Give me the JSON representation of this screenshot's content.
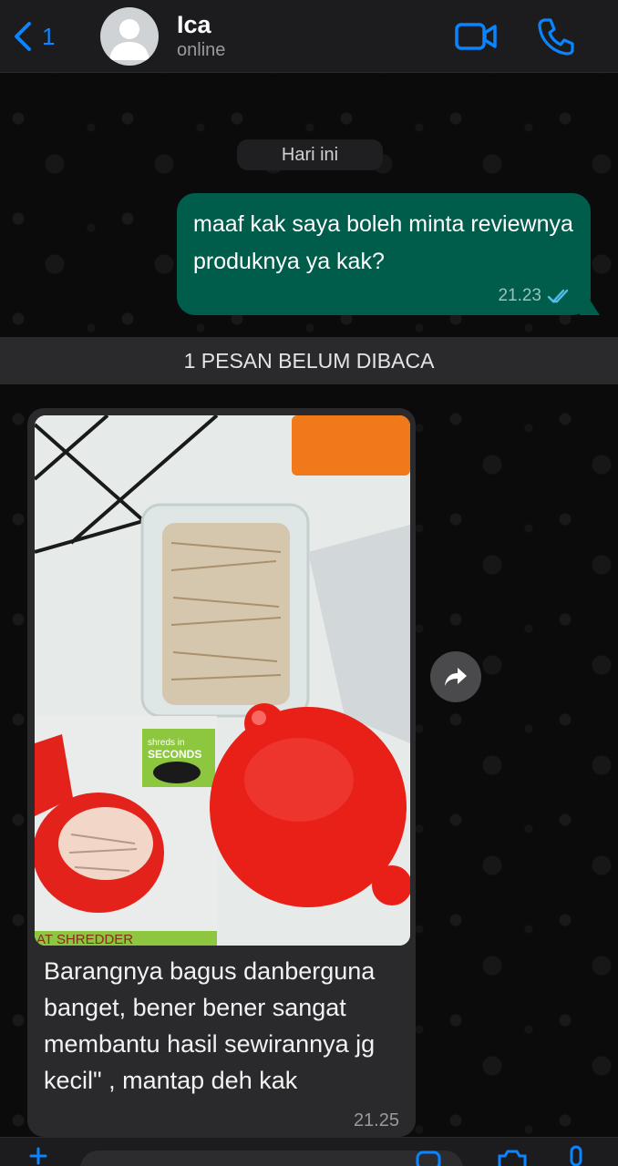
{
  "header": {
    "back_count": "1",
    "contact_name": "Ica",
    "status": "online",
    "accent_color": "#0a84ff"
  },
  "chat": {
    "day_label": "Hari ini",
    "outgoing": {
      "text": "maaf kak saya boleh minta reviewnya produknya ya kak?",
      "time": "21.23",
      "receipt_icon": "double-check-icon"
    },
    "unread_divider": "1 PESAN BELUM DIBACA",
    "incoming": {
      "photo_description_icon": "photo-attachment",
      "caption": "Barangnya bagus danberguna banget, bener bener sangat membantu hasil sewirannya jg kecil\" , mantap deh kak",
      "time": "21.25"
    }
  },
  "photo_labels": {
    "box_text": "shreds in SECONDS",
    "brand_text": "AT SHREDDER"
  },
  "colors": {
    "outgoing_bubble": "#005c4b",
    "incoming_bubble": "#2a2a2c",
    "background": "#0b0b0b"
  }
}
